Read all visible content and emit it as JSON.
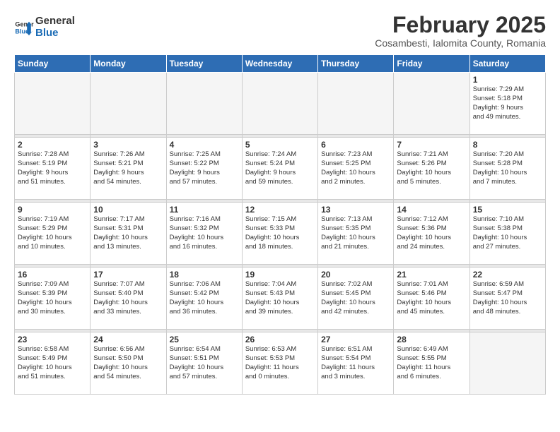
{
  "header": {
    "logo_line1": "General",
    "logo_line2": "Blue",
    "title": "February 2025",
    "subtitle": "Cosambesti, Ialomita County, Romania"
  },
  "weekdays": [
    "Sunday",
    "Monday",
    "Tuesday",
    "Wednesday",
    "Thursday",
    "Friday",
    "Saturday"
  ],
  "weeks": [
    [
      {
        "day": "",
        "info": ""
      },
      {
        "day": "",
        "info": ""
      },
      {
        "day": "",
        "info": ""
      },
      {
        "day": "",
        "info": ""
      },
      {
        "day": "",
        "info": ""
      },
      {
        "day": "",
        "info": ""
      },
      {
        "day": "1",
        "info": "Sunrise: 7:29 AM\nSunset: 5:18 PM\nDaylight: 9 hours\nand 49 minutes."
      }
    ],
    [
      {
        "day": "2",
        "info": "Sunrise: 7:28 AM\nSunset: 5:19 PM\nDaylight: 9 hours\nand 51 minutes."
      },
      {
        "day": "3",
        "info": "Sunrise: 7:26 AM\nSunset: 5:21 PM\nDaylight: 9 hours\nand 54 minutes."
      },
      {
        "day": "4",
        "info": "Sunrise: 7:25 AM\nSunset: 5:22 PM\nDaylight: 9 hours\nand 57 minutes."
      },
      {
        "day": "5",
        "info": "Sunrise: 7:24 AM\nSunset: 5:24 PM\nDaylight: 9 hours\nand 59 minutes."
      },
      {
        "day": "6",
        "info": "Sunrise: 7:23 AM\nSunset: 5:25 PM\nDaylight: 10 hours\nand 2 minutes."
      },
      {
        "day": "7",
        "info": "Sunrise: 7:21 AM\nSunset: 5:26 PM\nDaylight: 10 hours\nand 5 minutes."
      },
      {
        "day": "8",
        "info": "Sunrise: 7:20 AM\nSunset: 5:28 PM\nDaylight: 10 hours\nand 7 minutes."
      }
    ],
    [
      {
        "day": "9",
        "info": "Sunrise: 7:19 AM\nSunset: 5:29 PM\nDaylight: 10 hours\nand 10 minutes."
      },
      {
        "day": "10",
        "info": "Sunrise: 7:17 AM\nSunset: 5:31 PM\nDaylight: 10 hours\nand 13 minutes."
      },
      {
        "day": "11",
        "info": "Sunrise: 7:16 AM\nSunset: 5:32 PM\nDaylight: 10 hours\nand 16 minutes."
      },
      {
        "day": "12",
        "info": "Sunrise: 7:15 AM\nSunset: 5:33 PM\nDaylight: 10 hours\nand 18 minutes."
      },
      {
        "day": "13",
        "info": "Sunrise: 7:13 AM\nSunset: 5:35 PM\nDaylight: 10 hours\nand 21 minutes."
      },
      {
        "day": "14",
        "info": "Sunrise: 7:12 AM\nSunset: 5:36 PM\nDaylight: 10 hours\nand 24 minutes."
      },
      {
        "day": "15",
        "info": "Sunrise: 7:10 AM\nSunset: 5:38 PM\nDaylight: 10 hours\nand 27 minutes."
      }
    ],
    [
      {
        "day": "16",
        "info": "Sunrise: 7:09 AM\nSunset: 5:39 PM\nDaylight: 10 hours\nand 30 minutes."
      },
      {
        "day": "17",
        "info": "Sunrise: 7:07 AM\nSunset: 5:40 PM\nDaylight: 10 hours\nand 33 minutes."
      },
      {
        "day": "18",
        "info": "Sunrise: 7:06 AM\nSunset: 5:42 PM\nDaylight: 10 hours\nand 36 minutes."
      },
      {
        "day": "19",
        "info": "Sunrise: 7:04 AM\nSunset: 5:43 PM\nDaylight: 10 hours\nand 39 minutes."
      },
      {
        "day": "20",
        "info": "Sunrise: 7:02 AM\nSunset: 5:45 PM\nDaylight: 10 hours\nand 42 minutes."
      },
      {
        "day": "21",
        "info": "Sunrise: 7:01 AM\nSunset: 5:46 PM\nDaylight: 10 hours\nand 45 minutes."
      },
      {
        "day": "22",
        "info": "Sunrise: 6:59 AM\nSunset: 5:47 PM\nDaylight: 10 hours\nand 48 minutes."
      }
    ],
    [
      {
        "day": "23",
        "info": "Sunrise: 6:58 AM\nSunset: 5:49 PM\nDaylight: 10 hours\nand 51 minutes."
      },
      {
        "day": "24",
        "info": "Sunrise: 6:56 AM\nSunset: 5:50 PM\nDaylight: 10 hours\nand 54 minutes."
      },
      {
        "day": "25",
        "info": "Sunrise: 6:54 AM\nSunset: 5:51 PM\nDaylight: 10 hours\nand 57 minutes."
      },
      {
        "day": "26",
        "info": "Sunrise: 6:53 AM\nSunset: 5:53 PM\nDaylight: 11 hours\nand 0 minutes."
      },
      {
        "day": "27",
        "info": "Sunrise: 6:51 AM\nSunset: 5:54 PM\nDaylight: 11 hours\nand 3 minutes."
      },
      {
        "day": "28",
        "info": "Sunrise: 6:49 AM\nSunset: 5:55 PM\nDaylight: 11 hours\nand 6 minutes."
      },
      {
        "day": "",
        "info": ""
      }
    ]
  ]
}
